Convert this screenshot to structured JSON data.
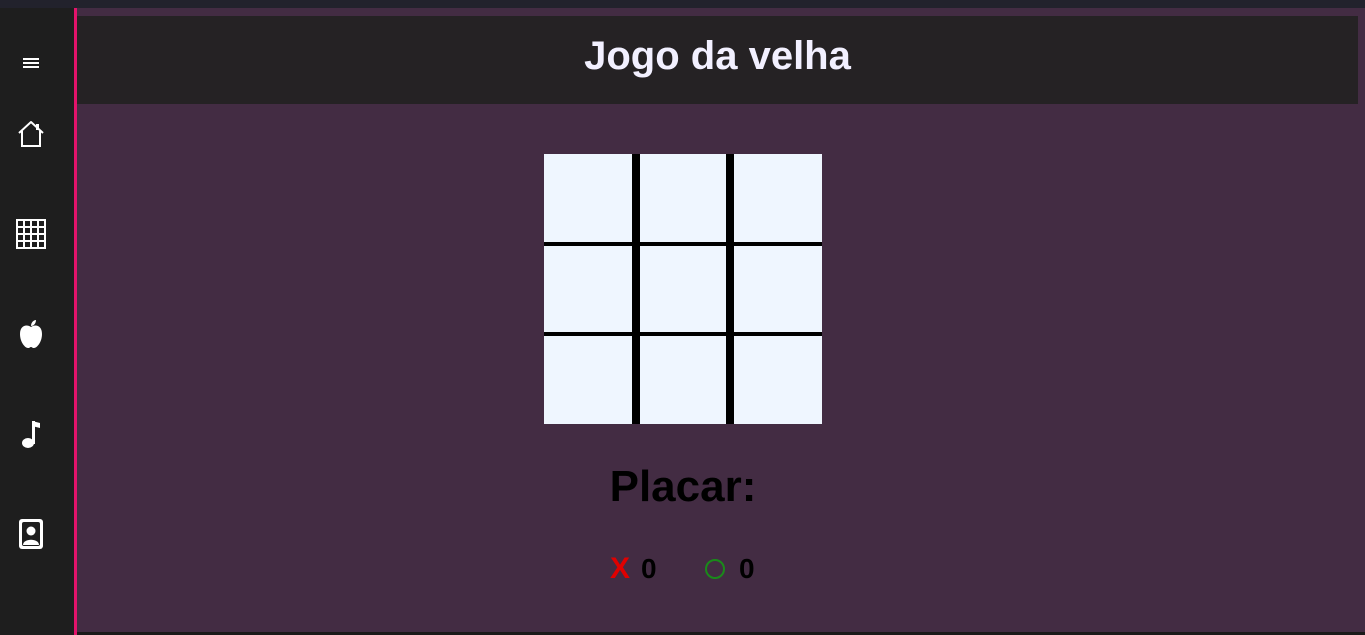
{
  "header": {
    "title": "Jogo da velha"
  },
  "sidebar": {
    "items": [
      {
        "icon": "menu-icon"
      },
      {
        "icon": "home-icon"
      },
      {
        "icon": "grid-icon"
      },
      {
        "icon": "apple-icon"
      },
      {
        "icon": "music-note-icon"
      },
      {
        "icon": "contact-icon"
      }
    ]
  },
  "board": {
    "cells": [
      "",
      "",
      "",
      "",
      "",
      "",
      "",
      "",
      ""
    ]
  },
  "score": {
    "title": "Placar:",
    "x_symbol": "X",
    "x_value": "0",
    "o_value": "0"
  },
  "colors": {
    "accent": "#e3136b",
    "main_bg": "#432c43",
    "header_bg": "#252224",
    "x_color": "#e00000",
    "o_color": "#1a8a1a",
    "cell_bg": "#eff6ff"
  }
}
